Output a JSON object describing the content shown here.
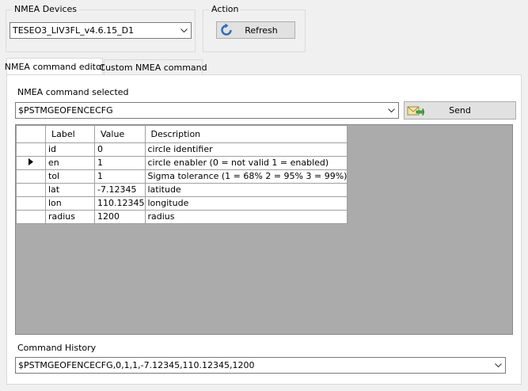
{
  "nmea_devices": {
    "title": "NMEA Devices",
    "selected": "TESEO3_LIV3FL_v4.6.15_D1"
  },
  "action": {
    "title": "Action",
    "refresh_label": "Refresh"
  },
  "tabs": [
    {
      "label": "NMEA command editor",
      "active": true
    },
    {
      "label": "Custom NMEA command",
      "active": false
    }
  ],
  "editor": {
    "command_label": "NMEA command selected",
    "command_selected": "$PSTMGEOFENCECFG",
    "send_label": "Send",
    "columns": [
      "Label",
      "Value",
      "Description"
    ],
    "rows": [
      {
        "label": "id",
        "value": "0",
        "description": "circle identifier",
        "current": false
      },
      {
        "label": "en",
        "value": "1",
        "description": "circle enabler (0 = not valid 1 = enabled)",
        "current": true
      },
      {
        "label": "tol",
        "value": "1",
        "description": "Sigma tolerance (1 = 68% 2 = 95% 3 = 99%)",
        "current": false
      },
      {
        "label": "lat",
        "value": "-7.12345",
        "description": "latitude",
        "current": false
      },
      {
        "label": "lon",
        "value": "110.12345",
        "description": "longitude",
        "current": false
      },
      {
        "label": "radius",
        "value": "1200",
        "description": "radius",
        "current": false
      }
    ],
    "history_label": "Command History",
    "history_value": "$PSTMGEOFENCECFG,0,1,1,-7.12345,110.12345,1200"
  },
  "colors": {
    "window_bg": "#f0f0f0",
    "grid_bg": "#ababab",
    "button_bg": "#e1e1e1",
    "tab_panel_bg": "#ffffff"
  }
}
